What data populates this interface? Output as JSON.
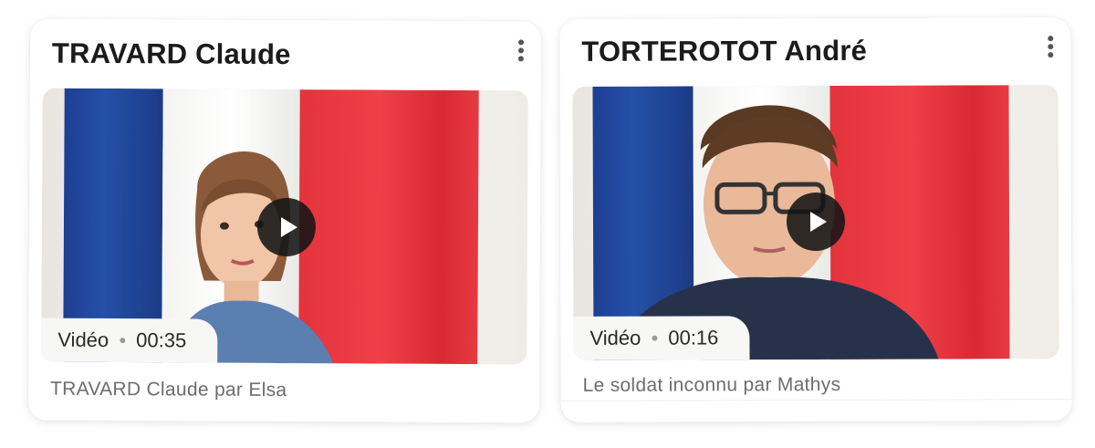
{
  "cards": [
    {
      "title": "TRAVARD Claude",
      "media_type": "Vidéo",
      "duration": "00:35",
      "caption": "TRAVARD Claude par Elsa",
      "menu_icon": "more-vertical-icon",
      "play_icon": "play-icon"
    },
    {
      "title": "TORTEROTOT André",
      "media_type": "Vidéo",
      "duration": "00:16",
      "caption": "Le soldat inconnu par Mathys",
      "menu_icon": "more-vertical-icon",
      "play_icon": "play-icon"
    }
  ],
  "colors": {
    "title": "#1b1b1b",
    "caption": "#6d6d6d",
    "play_button": "#141414",
    "flag_blue": "#2550a8",
    "flag_white": "#ffffff",
    "flag_red": "#ef4048"
  }
}
